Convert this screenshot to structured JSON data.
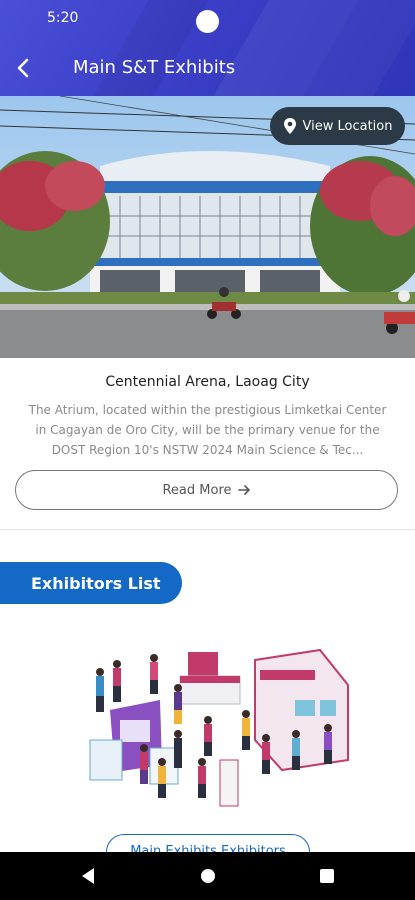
{
  "status_bar": {
    "time": "5:20"
  },
  "header": {
    "title": "Main S&T Exhibits"
  },
  "hero": {
    "view_location_label": "View Location"
  },
  "venue": {
    "name": "Centennial Arena, Laoag City",
    "description": "The Atrium, located within the prestigious Limketkai Center in Cagayan de Oro City, will be the primary venue for the DOST Region 10's NSTW 2024 Main Science & Tec...",
    "read_more_label": "Read More"
  },
  "exhibitors": {
    "tab_label": "Exhibitors List",
    "next_button_label": "Main Exhibits Exhibitors"
  },
  "colors": {
    "header_blue": "#3b3ec6",
    "accent_blue": "#1468c6",
    "location_pill": "#2b3a46"
  },
  "icons": [
    "back-arrow-icon",
    "location-pin-icon",
    "arrow-right-icon",
    "nav-back-icon",
    "nav-home-icon",
    "nav-recents-icon"
  ]
}
